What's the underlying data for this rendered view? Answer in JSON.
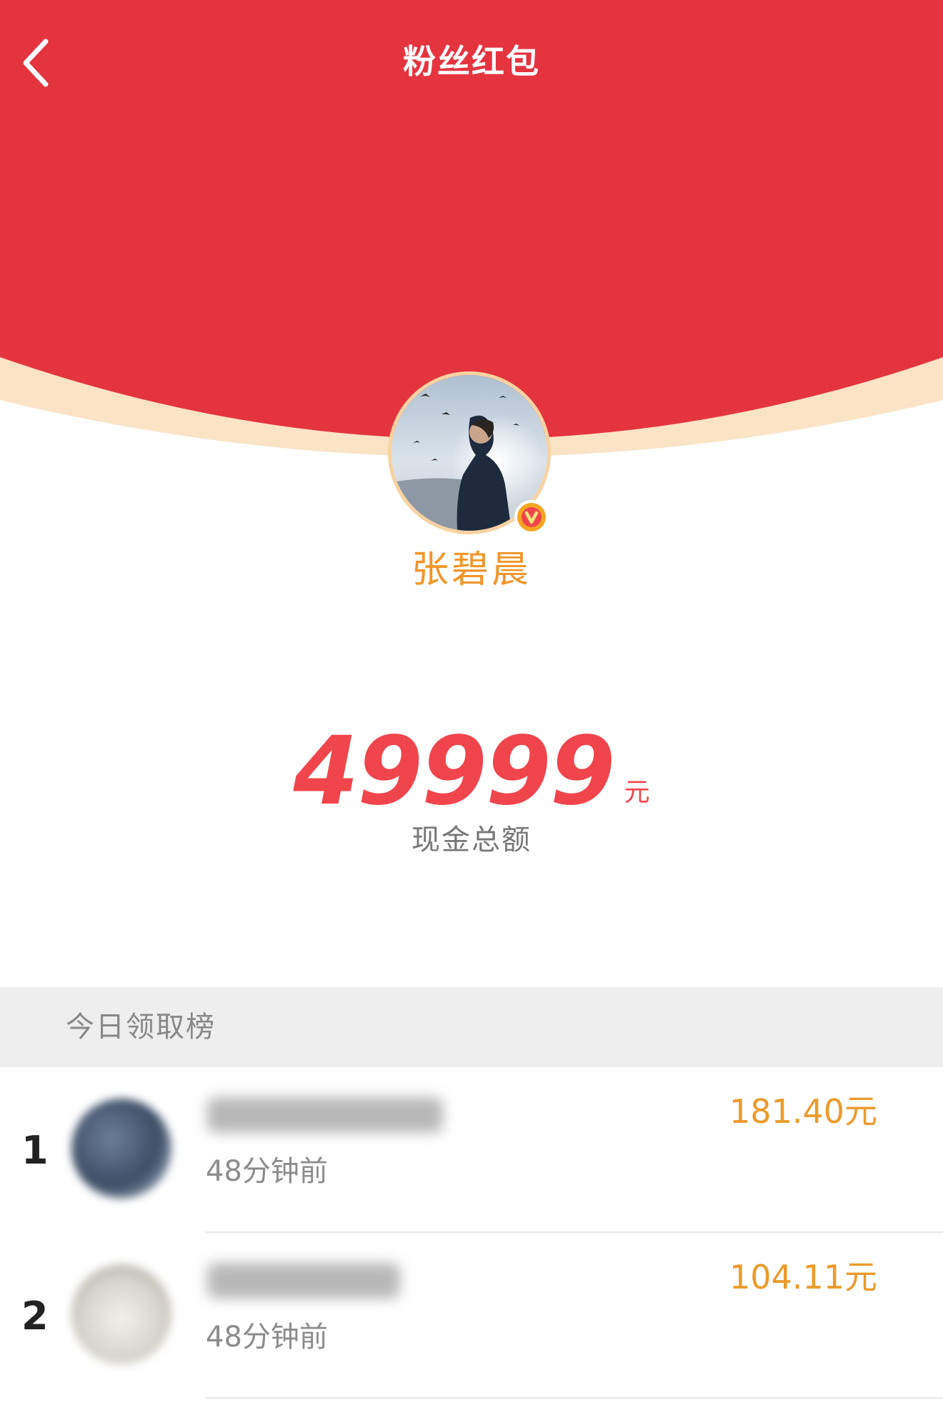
{
  "header": {
    "title": "粉丝红包",
    "back_icon": "chevron-left-icon",
    "background_color": "#e4343f",
    "accent_arc_color": "#fbe3c6"
  },
  "owner": {
    "name": "张碧晨",
    "verified_icon": "verified-v-icon",
    "verified_badge_color": "#f5a623"
  },
  "amount": {
    "value": "49999",
    "unit": "元",
    "label": "现金总额",
    "color": "#f0454c"
  },
  "ranking": {
    "title": "今日领取榜",
    "entries": [
      {
        "rank": "1",
        "time": "48分钟前",
        "amount": "181.40元"
      },
      {
        "rank": "2",
        "time": "48分钟前",
        "amount": "104.11元"
      }
    ]
  }
}
